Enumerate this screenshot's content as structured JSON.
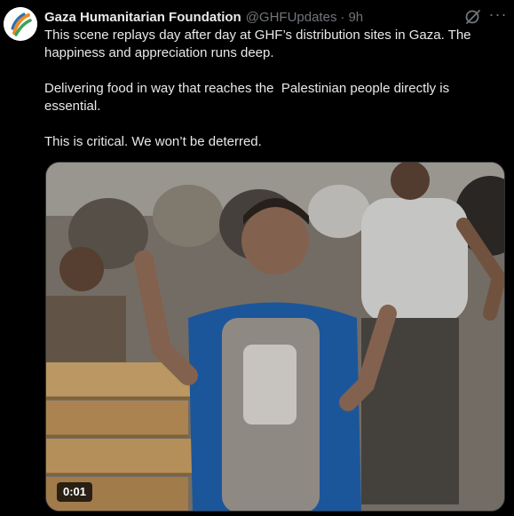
{
  "author": {
    "name": "Gaza Humanitarian Foundation",
    "handle": "@GHFUpdates",
    "separator": "·",
    "time": "9h",
    "avatar_icon": "ghf-logo-icon"
  },
  "actions": {
    "grok_icon": "grok-icon",
    "more_label": "···"
  },
  "tweet": {
    "paragraphs": [
      "This scene replays day after day at GHF’s distribution sites in Gaza. The happiness and appreciation runs deep.",
      "Delivering food in way that reaches the  Palestinian people directly is essential.",
      "This is critical. We won’t be deterred."
    ]
  },
  "video": {
    "duration": "0:01"
  },
  "colors": {
    "background": "#000000",
    "text": "#e7e9ea",
    "secondary": "#71767b",
    "logo_orange": "#f08a24",
    "logo_green": "#3aa35b",
    "logo_blue": "#2a6fb3"
  }
}
